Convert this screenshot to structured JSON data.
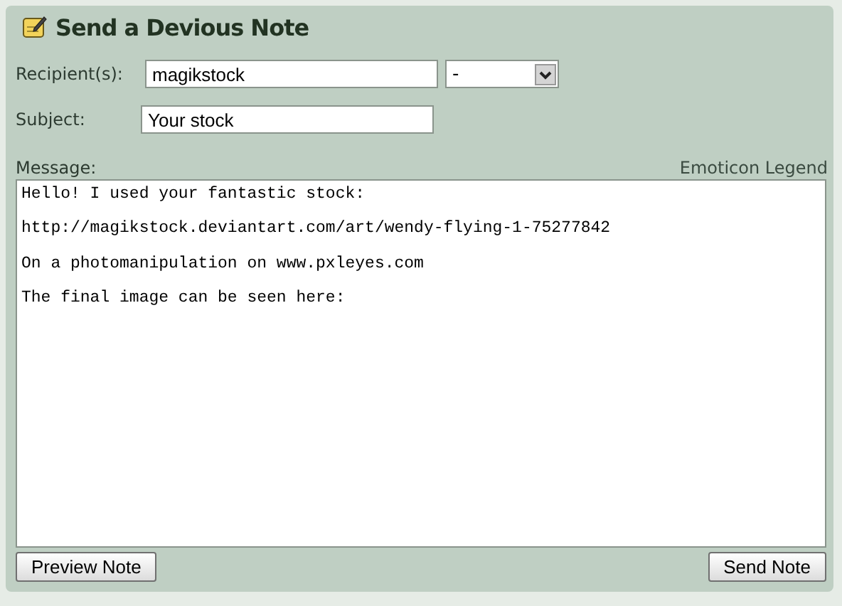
{
  "title": "Send a Devious Note",
  "recipient": {
    "label": "Recipient(s):",
    "value": "magikstock",
    "dropdown": "-"
  },
  "subject": {
    "label": "Subject:",
    "value": "Your stock"
  },
  "message": {
    "label": "Message:",
    "legend_link": "Emoticon Legend",
    "value": "Hello! I used your fantastic stock:\n\nhttp://magikstock.deviantart.com/art/wendy-flying-1-75277842\n\nOn a photomanipulation on www.pxleyes.com\n\nThe final image can be seen here:"
  },
  "buttons": [
    "Preview Note",
    "Send Note"
  ]
}
